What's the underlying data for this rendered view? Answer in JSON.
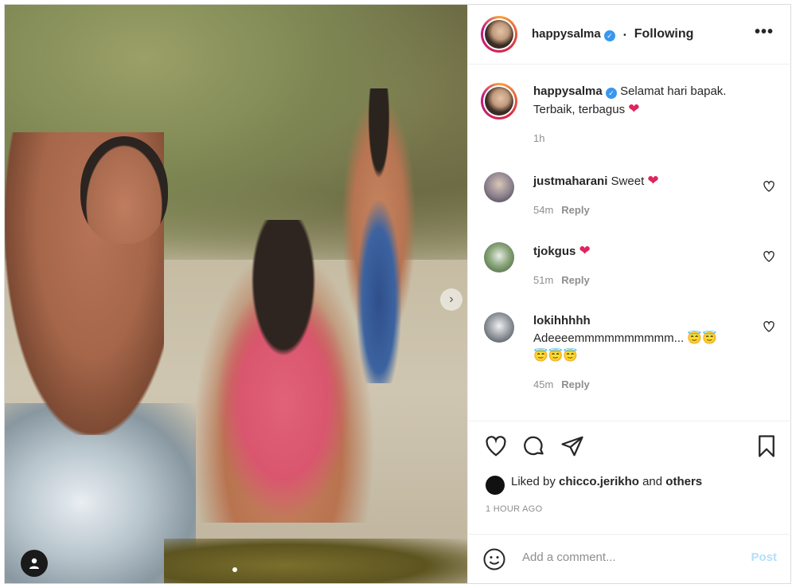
{
  "post": {
    "author": "happysalma",
    "follow_status": "Following",
    "separator": "•",
    "more_icon": "•••",
    "caption_line1": "Selamat hari bapak.",
    "caption_line2": "Terbaik, terbagus",
    "caption_emoji": "❤",
    "caption_time": "1h",
    "carousel_next_icon": "›"
  },
  "comments": [
    {
      "user": "justmaharani",
      "text": "Sweet",
      "emoji": "❤",
      "time": "54m",
      "reply": "Reply"
    },
    {
      "user": "tjokgus",
      "text": "",
      "emoji": "❤",
      "time": "51m",
      "reply": "Reply"
    },
    {
      "user": "lokihhhhh",
      "text": "Adeeeemmmmmmmmmm...",
      "emoji_line1": "😇😇",
      "emoji_line2": "😇😇😇",
      "time": "45m",
      "reply": "Reply"
    }
  ],
  "likes": {
    "prefix": "Liked by",
    "user": "chicco.jerikho",
    "and": "and",
    "others": "others"
  },
  "timestamp": "1 HOUR AGO",
  "add_comment": {
    "placeholder": "Add a comment...",
    "post_label": "Post"
  },
  "colors": {
    "verified": "#3897f0",
    "post_button_disabled": "#b2dffc",
    "heart": "#e0245e"
  }
}
